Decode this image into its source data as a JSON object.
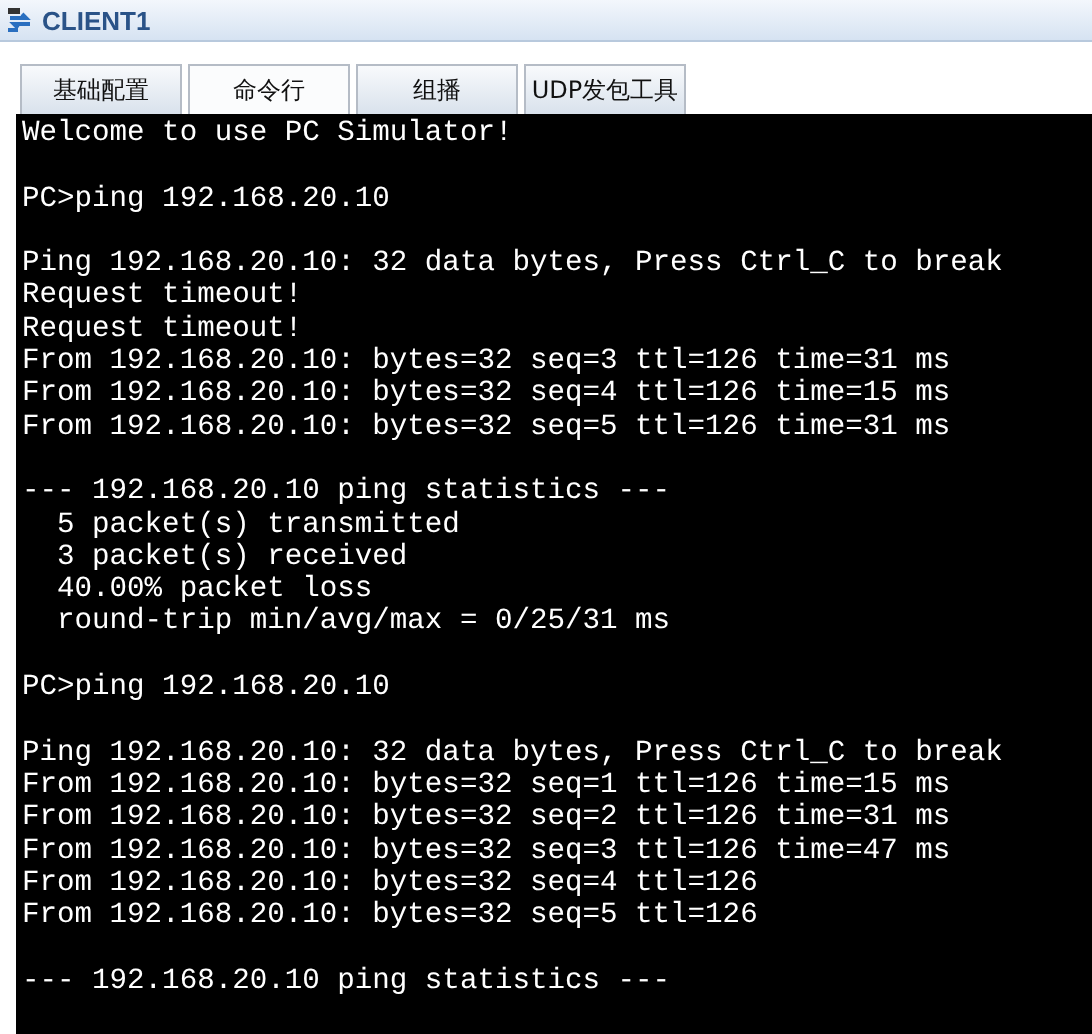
{
  "window": {
    "title": "CLIENT1"
  },
  "tabs": [
    {
      "label": "基础配置",
      "selected": false
    },
    {
      "label": "命令行",
      "selected": true
    },
    {
      "label": "组播",
      "selected": false
    },
    {
      "label": "UDP发包工具",
      "selected": false
    }
  ],
  "console": {
    "blocks": [
      [
        "Welcome to use PC Simulator!"
      ],
      [
        "PC>ping 192.168.20.10"
      ],
      [
        "Ping 192.168.20.10: 32 data bytes, Press Ctrl_C to break",
        "Request timeout!",
        "Request timeout!",
        "From 192.168.20.10: bytes=32 seq=3 ttl=126 time=31 ms",
        "From 192.168.20.10: bytes=32 seq=4 ttl=126 time=15 ms",
        "From 192.168.20.10: bytes=32 seq=5 ttl=126 time=31 ms"
      ],
      [
        "--- 192.168.20.10 ping statistics ---",
        "  5 packet(s) transmitted",
        "  3 packet(s) received",
        "  40.00% packet loss",
        "  round-trip min/avg/max = 0/25/31 ms"
      ],
      [
        "PC>ping 192.168.20.10"
      ],
      [
        "Ping 192.168.20.10: 32 data bytes, Press Ctrl_C to break",
        "From 192.168.20.10: bytes=32 seq=1 ttl=126 time=15 ms",
        "From 192.168.20.10: bytes=32 seq=2 ttl=126 time=31 ms",
        "From 192.168.20.10: bytes=32 seq=3 ttl=126 time=47 ms",
        "From 192.168.20.10: bytes=32 seq=4 ttl=126",
        "From 192.168.20.10: bytes=32 seq=5 ttl=126"
      ],
      [
        "--- 192.168.20.10 ping statistics ---"
      ]
    ]
  }
}
